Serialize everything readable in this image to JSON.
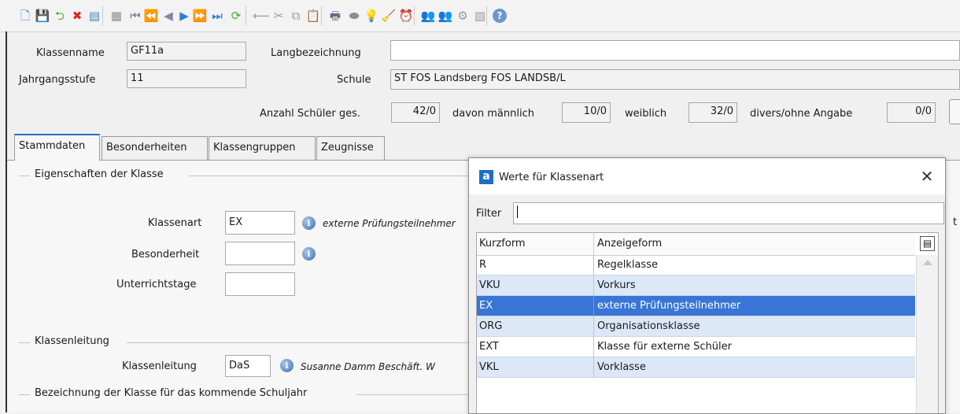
{
  "toolbar": {
    "buttons": [
      {
        "name": "new-document-icon",
        "glyph": "🗋",
        "color": "#2f7fd3"
      },
      {
        "name": "save-icon",
        "glyph": "💾",
        "color": "#2f7fd3"
      },
      {
        "name": "undo-icon",
        "glyph": "⮌",
        "color": "#3fae2a"
      },
      {
        "name": "delete-icon",
        "glyph": "✖",
        "color": "#e02525"
      },
      {
        "name": "form-icon",
        "glyph": "▤",
        "color": "#4a7fc0"
      },
      {
        "name": "grid-view-icon",
        "glyph": "▦",
        "color": "#8c8c8c"
      },
      {
        "name": "first-record-icon",
        "glyph": "⏮",
        "color": "#7d8aa3"
      },
      {
        "name": "rewind-icon",
        "glyph": "⏪",
        "color": "#7d8aa3"
      },
      {
        "name": "previous-icon",
        "glyph": "◀",
        "color": "#7d8aa3"
      },
      {
        "name": "next-icon",
        "glyph": "▶",
        "color": "#2f7fd3"
      },
      {
        "name": "fast-forward-icon",
        "glyph": "⏩",
        "color": "#2f7fd3"
      },
      {
        "name": "last-record-icon",
        "glyph": "⏭",
        "color": "#2f7fd3"
      },
      {
        "name": "refresh-icon",
        "glyph": "⟳",
        "color": "#3fae2a"
      },
      {
        "name": "back-arrow-icon",
        "glyph": "⟵",
        "color": "#9a9a9a"
      },
      {
        "name": "cut-icon",
        "glyph": "✂",
        "color": "#9a9a9a"
      },
      {
        "name": "copy-icon",
        "glyph": "⧉",
        "color": "#9a9a9a"
      },
      {
        "name": "paste-icon",
        "glyph": "📋",
        "color": "#9a9a9a"
      },
      {
        "name": "print-icon",
        "glyph": "🖶",
        "color": "#5e6f85"
      },
      {
        "name": "preview-icon",
        "glyph": "⬬",
        "color": "#8c8c8c"
      },
      {
        "name": "lightbulb-icon",
        "glyph": "💡",
        "color": "#e0b020"
      },
      {
        "name": "broom-icon",
        "glyph": "🧹",
        "color": "#d89a2a"
      },
      {
        "name": "alarm-clock-icon",
        "glyph": "⏰",
        "color": "#e08a20"
      },
      {
        "name": "users-icon",
        "glyph": "👥",
        "color": "#9a9a9a"
      },
      {
        "name": "users-edit-icon",
        "glyph": "👥",
        "color": "#9a9a9a"
      },
      {
        "name": "settings-circle-icon",
        "glyph": "⚙",
        "color": "#9a9a9a"
      },
      {
        "name": "report-icon",
        "glyph": "▧",
        "color": "#9a9a9a"
      },
      {
        "name": "help-icon",
        "glyph": "?",
        "color": "#3d6fae"
      }
    ]
  },
  "header": {
    "klassenname_label": "Klassenname",
    "klassenname_value": "GF11a",
    "langbezeichnung_label": "Langbezeichnung",
    "langbezeichnung_value": "",
    "jahrgangsstufe_label": "Jahrgangsstufe",
    "jahrgangsstufe_value": "11",
    "schule_label": "Schule",
    "schule_value": "ST FOS Landsberg FOS LANDSB/L",
    "anzahl_label": "Anzahl Schüler ges.",
    "anzahl_value": "42/0",
    "maennlich_label": "davon männlich",
    "maennlich_value": "10/0",
    "weiblich_label": "weiblich",
    "weiblich_value": "32/0",
    "divers_label": "divers/ohne Angabe",
    "divers_value": "0/0"
  },
  "tabs": [
    "Stammdaten",
    "Besonderheiten",
    "Klassengruppen",
    "Zeugnisse"
  ],
  "stammdaten": {
    "group_eigenschaften": "Eigenschaften der Klasse",
    "klassenart_label": "Klassenart",
    "klassenart_value": "EX",
    "klassenart_desc": "externe Prüfungsteilnehmer",
    "besonderheit_label": "Besonderheit",
    "besonderheit_value": "",
    "unterrichtstage_label": "Unterrichtstage",
    "unterrichtstage_value": "",
    "group_klassenleitung": "Klassenleitung",
    "klassenleitung_label": "Klassenleitung",
    "klassenleitung_value": "DaS",
    "klassenleitung_desc": "Susanne Damm Beschäft. W",
    "group_bezeichnung": "Bezeichnung der Klasse für das kommende Schuljahr",
    "right_edge_char": "t"
  },
  "dialog": {
    "icon_letter": "a",
    "title": "Werte für Klassenart",
    "filter_label": "Filter",
    "filter_value": "",
    "col_kurzform": "Kurzform",
    "col_anzeigeform": "Anzeigeform",
    "rows": [
      {
        "kurz": "R",
        "anzeige": "Regelklasse",
        "style": "plain"
      },
      {
        "kurz": "VKU",
        "anzeige": "Vorkurs",
        "style": "alt"
      },
      {
        "kurz": "EX",
        "anzeige": "externe Prüfungsteilnehmer",
        "style": "sel"
      },
      {
        "kurz": "ORG",
        "anzeige": "Organisationsklasse",
        "style": "alt"
      },
      {
        "kurz": "EXT",
        "anzeige": "Klasse für externe Schüler",
        "style": "plain"
      },
      {
        "kurz": "VKL",
        "anzeige": "Vorklasse",
        "style": "alt"
      }
    ]
  }
}
